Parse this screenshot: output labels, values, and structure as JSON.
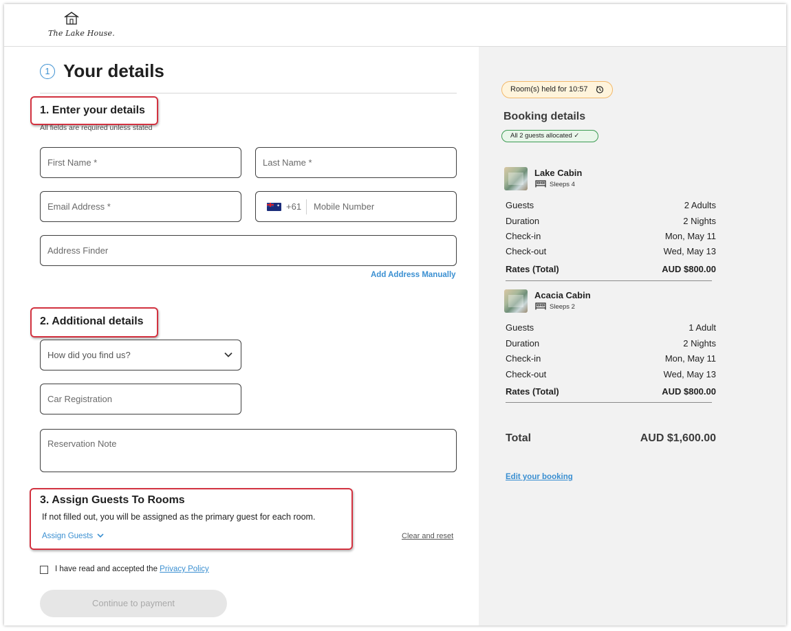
{
  "header": {
    "logo_text": "The Lake House."
  },
  "page": {
    "step_number": "1",
    "title": "Your details"
  },
  "section1": {
    "title": "1. Enter your details",
    "note": "All fields are required unless stated",
    "first_name_placeholder": "First Name *",
    "last_name_placeholder": "Last Name *",
    "email_placeholder": "Email Address *",
    "dial_code": "+61",
    "mobile_placeholder": "Mobile Number",
    "address_placeholder": "Address Finder",
    "add_address_manually": "Add Address Manually"
  },
  "section2": {
    "title": "2. Additional details",
    "how_found_placeholder": "How did you find us?",
    "car_registration_placeholder": "Car Registration",
    "reservation_note_placeholder": "Reservation Note"
  },
  "section3": {
    "title": "3. Assign Guests To Rooms",
    "description": "If not filled out, you will be assigned as the primary guest for each room.",
    "assign_guests_link": "Assign Guests",
    "clear_reset_link": "Clear and reset"
  },
  "consent": {
    "text": "I have read and accepted the ",
    "link": "Privacy Policy"
  },
  "continue_button": "Continue to payment",
  "booking": {
    "timer": "Room(s) held for 10:57",
    "title": "Booking details",
    "allocation": "All 2 guests allocated ✓",
    "rooms": [
      {
        "name": "Lake Cabin",
        "sleeps": "Sleeps 4",
        "guests_label": "Guests",
        "guests_value": "2 Adults",
        "duration_label": "Duration",
        "duration_value": "2 Nights",
        "checkin_label": "Check-in",
        "checkin_value": "Mon, May 11",
        "checkout_label": "Check-out",
        "checkout_value": "Wed, May 13",
        "rates_label": "Rates (Total)",
        "rates_value": "AUD $800.00"
      },
      {
        "name": "Acacia Cabin",
        "sleeps": "Sleeps 2",
        "guests_label": "Guests",
        "guests_value": "1 Adult",
        "duration_label": "Duration",
        "duration_value": "2 Nights",
        "checkin_label": "Check-in",
        "checkin_value": "Mon, May 11",
        "checkout_label": "Check-out",
        "checkout_value": "Wed, May 13",
        "rates_label": "Rates (Total)",
        "rates_value": "AUD $800.00"
      }
    ],
    "total_label": "Total",
    "total_value": "AUD $1,600.00",
    "edit_link": "Edit your booking"
  },
  "colors": {
    "accent_blue": "#3a8fd1",
    "highlight_red": "#d2313f",
    "timer_border": "#f2b86a",
    "allocated_green": "#3b9a52",
    "panel_bg": "#f2f2f2"
  },
  "icons": {
    "logo": "house-logo-icon",
    "select": "chevron-down-icon",
    "timer": "timer-icon",
    "bed": "bed-icon",
    "flag": "australia-flag-icon"
  }
}
